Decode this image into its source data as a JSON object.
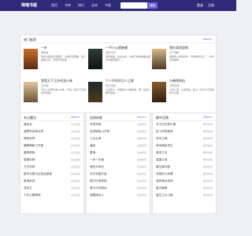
{
  "topbar": {
    "logo": "锦瑞书屋",
    "nav": [
      "首页",
      "书库",
      "排行",
      "全本",
      "书架"
    ],
    "search_btn": "搜索",
    "login": "登录",
    "register": "注册"
  },
  "featured": {
    "title": "热门推荐",
    "more": "More+",
    "books": [
      {
        "title": "一叶",
        "author": "夜雨秋",
        "desc": "修炼之路漫长而艰辛，主角历经磨难，踏上巅峰之途，谱写传奇篇章……"
      },
      {
        "title": "一不小心就被缠",
        "author": "墨染青衣",
        "desc": "意外相遇，命运交织，纠缠不休的故事在都市中缓缓展开……"
      },
      {
        "title": "我在游戏里做",
        "author": "月下独酌",
        "desc": "穿越进入游戏世界，凭借前世记忆，一步步走向巅峰……"
      },
      {
        "title": "我是天下之外的女仆妹",
        "author": "云中鹤",
        "desc": "平凡少女意外卷入纷争，开启一段不平凡的冒险旅程……"
      },
      {
        "title": "个人开的早点人之陵",
        "author": "风过无痕",
        "desc": "小店虽小，却藏着大大的秘密，每一位客人都有故事……"
      },
      {
        "title": "与善缘修仙",
        "author": "清风徐来",
        "desc": "以善入道，以缘修仙，踏上一条与众不同的修行之路……"
      }
    ]
  },
  "lists": [
    {
      "title": "玄幻魔法",
      "more": "More+",
      "items": [
        {
          "name": "道纪谈",
          "meta": "玄幻魔法"
        },
        {
          "name": "诸界的战争往来",
          "meta": "玄幻魔法"
        },
        {
          "name": "神佑世界",
          "meta": "玄幻魔法"
        },
        {
          "name": "魔教萌新工作室",
          "meta": "玄幻魔法"
        },
        {
          "name": "重修修炼",
          "meta": "玄幻魔法"
        },
        {
          "name": "制霸剑神",
          "meta": "玄幻魔法"
        },
        {
          "name": "万古剑帝",
          "meta": "玄幻魔法"
        },
        {
          "name": "都市元素与社会运营者",
          "meta": "玄幻魔法"
        },
        {
          "name": "星海传说",
          "meta": "玄幻魔法"
        },
        {
          "name": "亚特兰",
          "meta": "玄幻魔法"
        },
        {
          "name": "十年心酸等修",
          "meta": "玄幻魔法"
        }
      ]
    },
    {
      "title": "仙侠修真",
      "more": "More+",
      "items": [
        {
          "name": "洪荒开局",
          "meta": "仙侠修真"
        },
        {
          "name": "自然轻松山不易",
          "meta": "仙侠修真"
        },
        {
          "name": "上古九帝",
          "meta": "仙侠修真"
        },
        {
          "name": "道经",
          "meta": "仙侠修真"
        },
        {
          "name": "星海",
          "meta": "仙侠修真"
        },
        {
          "name": "一步一天境",
          "meta": "仙侠修真"
        },
        {
          "name": "我的大师兄",
          "meta": "仙侠修真"
        },
        {
          "name": "在长安做天官",
          "meta": "仙侠修真"
        },
        {
          "name": "提升日常修炼",
          "meta": "仙侠修真"
        },
        {
          "name": "提示分性修仙",
          "meta": "仙侠修真"
        },
        {
          "name": "我要成仙人",
          "meta": "仙侠修真"
        }
      ]
    },
    {
      "title": "都市言情",
      "more": "More+",
      "items": [
        {
          "name": "长子正在修行道",
          "meta": "都市言情"
        },
        {
          "name": "恋上你的微笑",
          "meta": "都市言情"
        },
        {
          "name": "时光之城",
          "meta": "都市言情"
        },
        {
          "name": "前世缘定来生",
          "meta": "都市言情"
        },
        {
          "name": "城市之光",
          "meta": "都市言情"
        },
        {
          "name": "温柔以待",
          "meta": "都市言情"
        },
        {
          "name": "重生娱乐圈",
          "meta": "都市言情"
        },
        {
          "name": "总裁的小娇妻",
          "meta": "都市言情"
        },
        {
          "name": "我的美女老师",
          "meta": "都市言情"
        },
        {
          "name": "星光璀璨",
          "meta": "都市言情"
        },
        {
          "name": "重生之大小姐",
          "meta": "都市言情"
        }
      ]
    }
  ],
  "colors": {
    "brand": "#2f2b78",
    "accent": "#6f63d9"
  }
}
